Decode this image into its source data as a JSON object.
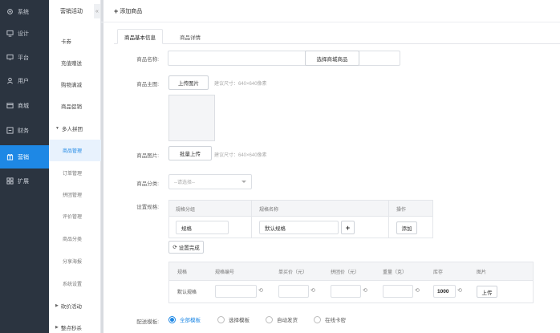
{
  "sidebar": {
    "items": [
      {
        "label": "系统",
        "icon": "gear-icon"
      },
      {
        "label": "设计",
        "icon": "monitor-icon"
      },
      {
        "label": "平台",
        "icon": "platform-icon"
      },
      {
        "label": "用户",
        "icon": "user-icon"
      },
      {
        "label": "商城",
        "icon": "store-icon"
      },
      {
        "label": "财务",
        "icon": "finance-icon"
      },
      {
        "label": "营销",
        "icon": "marketing-icon"
      },
      {
        "label": "扩展",
        "icon": "grid-icon"
      }
    ],
    "active_index": 6
  },
  "submenu": {
    "header": "营销活动",
    "collapse_glyph": "«",
    "items": [
      {
        "label": "卡券"
      },
      {
        "label": "充值赠送"
      },
      {
        "label": "购物满减"
      },
      {
        "label": "商品促销"
      },
      {
        "label": "多人拼团",
        "group": true,
        "expanded": true
      },
      {
        "label": "商品管理",
        "sub": true,
        "active": true
      },
      {
        "label": "订单管理",
        "sub": true
      },
      {
        "label": "拼团管理",
        "sub": true
      },
      {
        "label": "评价管理",
        "sub": true
      },
      {
        "label": "商品分类",
        "sub": true
      },
      {
        "label": "分享海报",
        "sub": true
      },
      {
        "label": "系统设置",
        "sub": true
      },
      {
        "label": "砍价活动",
        "group": true
      },
      {
        "label": "整点秒杀",
        "group": true
      }
    ]
  },
  "topbar": {
    "plus": "+",
    "title": "添加商品"
  },
  "tabs": [
    {
      "label": "商品基本信息",
      "active": true
    },
    {
      "label": "商品详情",
      "active": false
    }
  ],
  "form": {
    "name_label": "商品名称:",
    "name_value": "",
    "select_store_goods": "选择商城商品",
    "main_image_label": "商品主图:",
    "upload_image": "上传图片",
    "size_hint": "建议尺寸：640×640像素",
    "gallery_label": "商品图片:",
    "batch_upload": "批量上传",
    "category_label": "商品分类:",
    "category_placeholder": "--请选择--",
    "spec_label": "设置规格:",
    "shipping_label": "配送模板:"
  },
  "spec_table": {
    "headers": [
      "规格分组",
      "规格名称",
      "操作"
    ],
    "group_value": "规格",
    "name_value": "默认规格",
    "add_glyph": "+",
    "add_button": "添加",
    "generate_button": "设置完成"
  },
  "sku_table": {
    "headers": [
      "规格",
      "规格编号",
      "单买价（元）",
      "拼团价（元）",
      "重量（克）",
      "库存",
      "图片"
    ],
    "row": {
      "spec": "默认规格",
      "code": "",
      "price": "",
      "group_price": "",
      "weight": "",
      "stock": "1000",
      "upload": "上传"
    }
  },
  "shipping_options": [
    {
      "label": "全部模板",
      "checked": true
    },
    {
      "label": "选择模板",
      "checked": false
    },
    {
      "label": "自动发货",
      "checked": false
    },
    {
      "label": "在线卡密",
      "checked": false
    }
  ],
  "colors": {
    "sidebar_bg": "#2b3440",
    "accent": "#1e88e5",
    "active_sub_bg": "#e8f2fd"
  }
}
